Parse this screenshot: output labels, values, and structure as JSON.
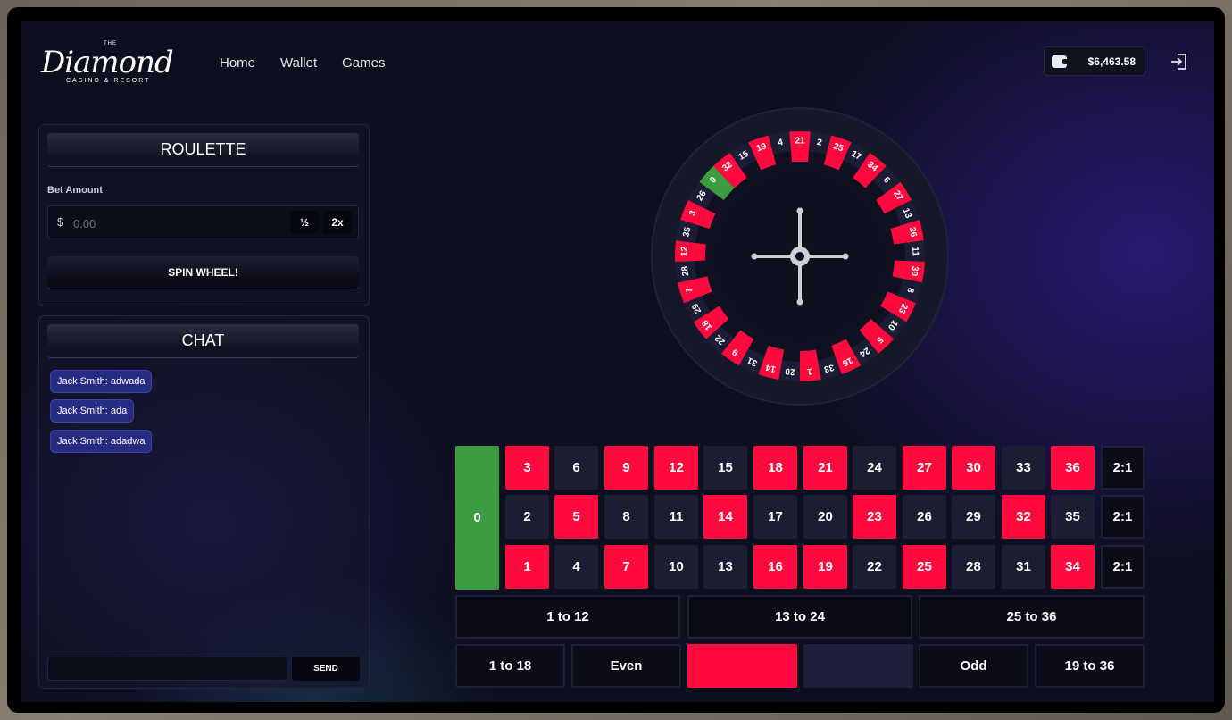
{
  "header": {
    "logo": {
      "the": "THE",
      "name": "Diamond",
      "tagline": "CASINO & RESORT"
    },
    "nav": [
      "Home",
      "Wallet",
      "Games"
    ],
    "balance": "$6,463.58"
  },
  "roulette_panel": {
    "title": "ROULETTE",
    "bet_label": "Bet Amount",
    "currency": "$",
    "bet_placeholder": "0.00",
    "half_label": "½",
    "double_label": "2x",
    "spin_label": "SPIN WHEEL!"
  },
  "chat": {
    "title": "CHAT",
    "messages": [
      "Jack Smith: adwada",
      "Jack Smith: ada",
      "Jack Smith: adadwa"
    ],
    "send_label": "SEND"
  },
  "wheel": {
    "numbers": [
      21,
      2,
      25,
      17,
      34,
      6,
      27,
      13,
      36,
      11,
      30,
      8,
      23,
      10,
      5,
      24,
      16,
      33,
      1,
      20,
      14,
      31,
      9,
      22,
      18,
      29,
      7,
      28,
      12,
      35,
      3,
      26,
      0,
      32,
      15,
      19,
      4
    ],
    "colors": {
      "red": "#fe0a3e",
      "black": "#1b1d35",
      "green": "#3d9b41"
    }
  },
  "board": {
    "zero": "0",
    "rows": [
      [
        3,
        6,
        9,
        12,
        15,
        18,
        21,
        24,
        27,
        30,
        33,
        36
      ],
      [
        2,
        5,
        8,
        11,
        14,
        17,
        20,
        23,
        26,
        29,
        32,
        35
      ],
      [
        1,
        4,
        7,
        10,
        13,
        16,
        19,
        22,
        25,
        28,
        31,
        34
      ]
    ],
    "red_numbers": [
      1,
      3,
      5,
      7,
      9,
      12,
      14,
      16,
      18,
      19,
      21,
      23,
      25,
      27,
      30,
      32,
      34,
      36
    ],
    "column_bet": "2:1",
    "dozens": [
      "1 to 12",
      "13 to 24",
      "25 to 36"
    ],
    "outside": {
      "low": "1 to 18",
      "even": "Even",
      "odd": "Odd",
      "high": "19 to 36"
    }
  }
}
